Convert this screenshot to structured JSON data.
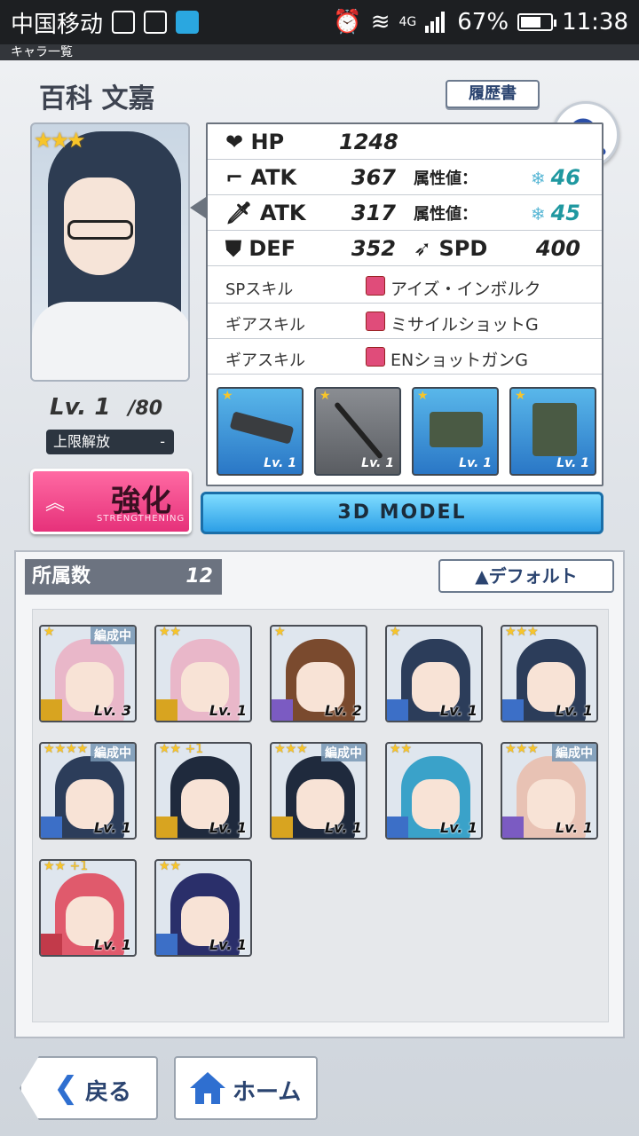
{
  "status_bar": {
    "carrier": "中国移动",
    "network": "4G",
    "battery": "67%",
    "battery_level": 0.67,
    "time": "11:38"
  },
  "header_strip": "キャラ一覧",
  "character": {
    "name": "百科 文嘉",
    "stars": "★★★",
    "level": "Lv. 1",
    "level_max": "/80",
    "limit_break_label": "上限解放",
    "limit_break_value": "-"
  },
  "buttons": {
    "history": "履歴書",
    "enhance": "強化",
    "enhance_sub": "STRENGTHENING",
    "model": "3D MODEL",
    "sort": "▲デフォルト",
    "back": "戻る",
    "home": "ホーム"
  },
  "stats": {
    "hp_label": "HP",
    "hp_value": "1248",
    "atk1_label": "ATK",
    "atk1_value": "367",
    "attr1_label": "属性値：",
    "attr1_value": "46",
    "atk2_label": "ATK",
    "atk2_value": "317",
    "attr2_label": "属性値：",
    "attr2_value": "45",
    "def_label": "DEF",
    "def_value": "352",
    "spd_label": "SPD",
    "spd_value": "400"
  },
  "skills": [
    {
      "type": "SPスキル",
      "name": "アイズ・インボルク"
    },
    {
      "type": "ギアスキル",
      "name": "ミサイルショットG"
    },
    {
      "type": "ギアスキル",
      "name": "ENショットガンG"
    }
  ],
  "gears": [
    {
      "stars": "★",
      "level": "Lv. 1"
    },
    {
      "stars": "★",
      "level": "Lv. 1"
    },
    {
      "stars": "★",
      "level": "Lv. 1"
    },
    {
      "stars": "★",
      "level": "Lv. 1"
    }
  ],
  "roster": {
    "count_label": "所属数",
    "count_value": "12",
    "cards": [
      {
        "stars": "★",
        "tag": "編成中",
        "level": "Lv. 3",
        "hair": "#e9b7c9"
      },
      {
        "stars": "★★",
        "tag": "",
        "level": "Lv. 1",
        "hair": "#e9b7c9"
      },
      {
        "stars": "★",
        "tag": "",
        "level": "Lv. 2",
        "hair": "#7a4a2e"
      },
      {
        "stars": "★",
        "tag": "",
        "level": "Lv. 1",
        "hair": "#2c3d5a"
      },
      {
        "stars": "★★★",
        "tag": "",
        "level": "Lv. 1",
        "hair": "#2c3d5a"
      },
      {
        "stars": "★★★★",
        "tag": "編成中",
        "level": "Lv. 1",
        "hair": "#2c3d5a"
      },
      {
        "stars": "★★ +1",
        "tag": "",
        "level": "Lv. 1",
        "hair": "#1f2a3d"
      },
      {
        "stars": "★★★",
        "tag": "編成中",
        "level": "Lv. 1",
        "hair": "#1f2a3d"
      },
      {
        "stars": "★★",
        "tag": "",
        "level": "Lv. 1",
        "hair": "#3aa2c9"
      },
      {
        "stars": "★★★",
        "tag": "編成中",
        "level": "Lv. 1",
        "hair": "#e8c2b4"
      },
      {
        "stars": "★★ +1",
        "tag": "",
        "level": "Lv. 1",
        "hair": "#e05a6c"
      },
      {
        "stars": "★★",
        "tag": "",
        "level": "Lv. 1",
        "hair": "#2a2f6a"
      }
    ]
  }
}
